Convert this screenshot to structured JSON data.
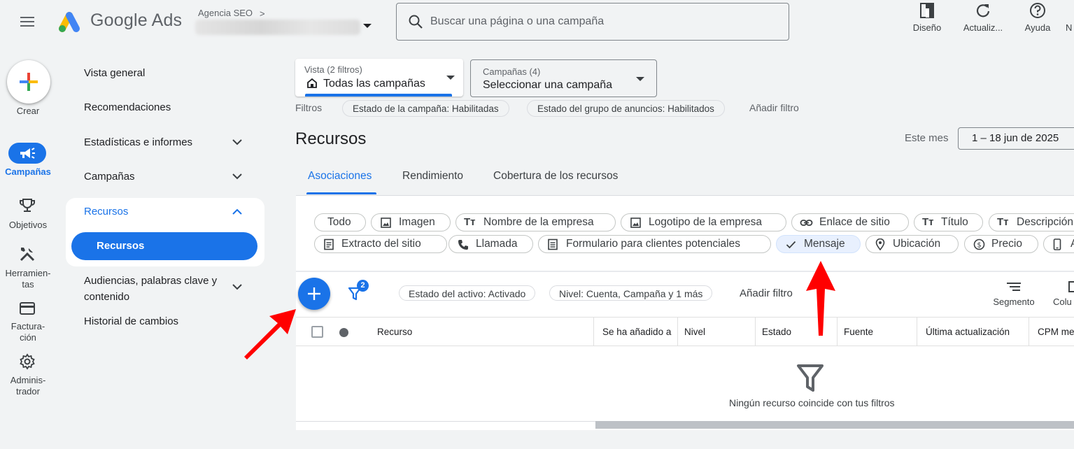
{
  "app": {
    "title": "Google Ads",
    "account_name": "Agencia SEO",
    "account_chevron": ">"
  },
  "search": {
    "placeholder": "Buscar una página o una campaña"
  },
  "toolbar": [
    {
      "label": "Diseño",
      "icon": "layout-icon"
    },
    {
      "label": "Actualiz...",
      "icon": "refresh-icon"
    },
    {
      "label": "Ayuda",
      "icon": "help-icon"
    },
    {
      "label": "N",
      "icon": "notifications-icon"
    }
  ],
  "rail": {
    "create": "Crear",
    "items": [
      {
        "label": "Campañas",
        "icon": "campaigns-icon",
        "active": true
      },
      {
        "label": "Objetivos",
        "icon": "trophy-icon"
      },
      {
        "label": "Herramien-\ntas",
        "icon": "tools-icon"
      },
      {
        "label": "Factura-\nción",
        "icon": "billing-icon"
      },
      {
        "label": "Adminis-\ntrador",
        "icon": "admin-icon"
      }
    ]
  },
  "nav": {
    "items": [
      {
        "label": "Vista general"
      },
      {
        "label": "Recomendaciones"
      },
      {
        "label": "Estadísticas e informes",
        "expandable": true
      },
      {
        "label": "Campañas",
        "expandable": true
      },
      {
        "label": "Recursos",
        "expanded": true,
        "children": [
          "Recursos"
        ]
      },
      {
        "label": "Audiencias, palabras clave y contenido",
        "expandable": true
      },
      {
        "label": "Historial de cambios"
      }
    ]
  },
  "view_selector": {
    "small": "Vista (2 filtros)",
    "value": "Todas las campañas"
  },
  "campaign_selector": {
    "small": "Campañas (4)",
    "value": "Seleccionar una campaña"
  },
  "filters": {
    "label": "Filtros",
    "chips": [
      "Estado de la campaña: Habilitadas",
      "Estado del grupo de anuncios: Habilitados"
    ],
    "add": "Añadir filtro"
  },
  "page": {
    "title": "Recursos",
    "date_label": "Este mes",
    "date_range": "1 – 18 jun de 2025"
  },
  "tabs": [
    "Asociaciones",
    "Rendimiento",
    "Cobertura de los recursos"
  ],
  "asset_types": {
    "row1": [
      "Todo",
      "Imagen",
      "Nombre de la empresa",
      "Logotipo de la empresa",
      "Enlace de sitio",
      "Título",
      "Descripción"
    ],
    "row2": [
      "Extracto del sitio",
      "Llamada",
      "Formulario para clientes potenciales",
      "Mensaje",
      "Ubicación",
      "Precio",
      "A"
    ],
    "selected": "Mensaje"
  },
  "table_toolbar": {
    "filter_count": "2",
    "chips": [
      "Estado del activo: Activado",
      "Nivel: Cuenta, Campaña y 1 más"
    ],
    "add_filter": "Añadir filtro",
    "segment": "Segmento",
    "columns": "Colu"
  },
  "table": {
    "columns": [
      "Recurso",
      "Se ha añadido a",
      "Nivel",
      "Estado",
      "Fuente",
      "Última actualización",
      "CPM me"
    ],
    "empty_message": "Ningún recurso coincide con tus filtros"
  },
  "colors": {
    "accent": "#1a73e8",
    "annotation_arrow": "#ff0000"
  }
}
